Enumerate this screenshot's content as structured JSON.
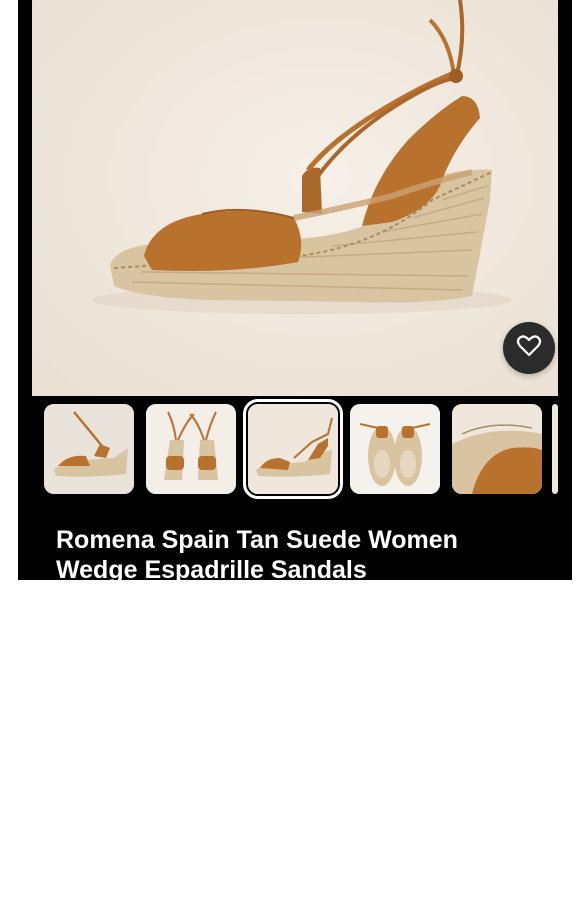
{
  "product": {
    "title": "Romena Spain Tan Suede Women Wedge Espadrille Sandals"
  },
  "gallery": {
    "selected_index": 2,
    "thumbnails": [
      {
        "alt": "side view lace-up"
      },
      {
        "alt": "front pair view"
      },
      {
        "alt": "side view"
      },
      {
        "alt": "bottom soles"
      },
      {
        "alt": "detail close-up"
      }
    ]
  },
  "icons": {
    "favorite": "heart-icon",
    "cursor": "pointer-cursor-icon"
  },
  "colors": {
    "suede": "#b8722e",
    "jute": "#d8c4a0",
    "background": "#efe6dc",
    "strip": "#000000",
    "heart_button": "#2b2b2b"
  }
}
